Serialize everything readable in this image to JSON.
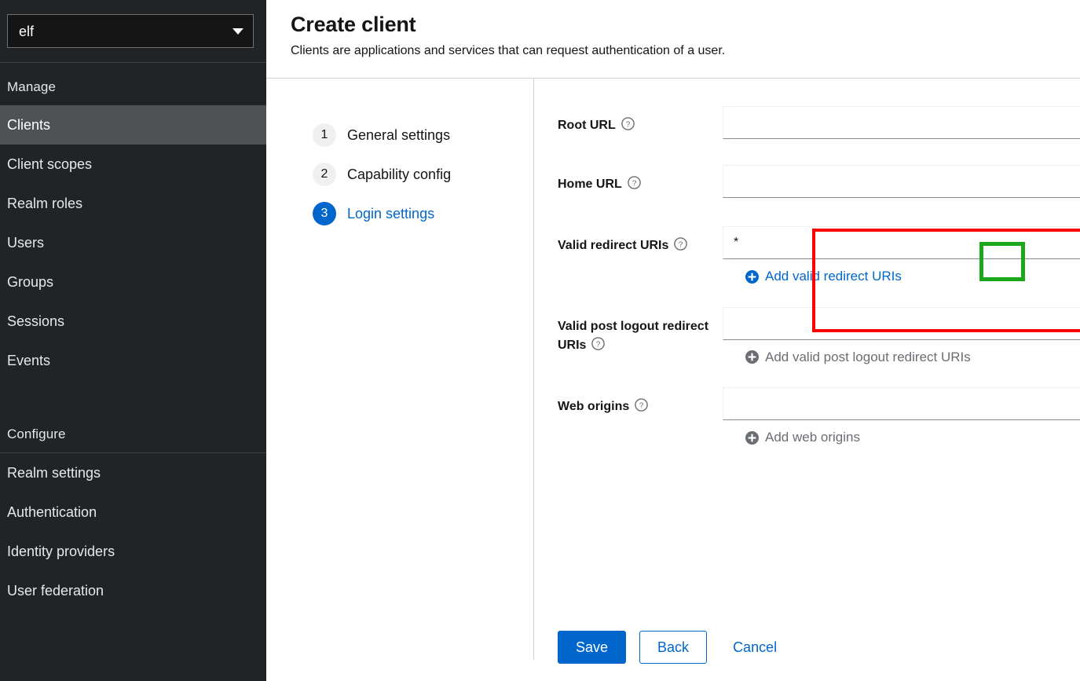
{
  "sidebar": {
    "realm_selector": {
      "value": "elf",
      "icon": "chevron-down-icon"
    },
    "groups": [
      {
        "title": "Manage",
        "items": [
          {
            "label": "Clients",
            "active": true
          },
          {
            "label": "Client scopes",
            "active": false
          },
          {
            "label": "Realm roles",
            "active": false
          },
          {
            "label": "Users",
            "active": false
          },
          {
            "label": "Groups",
            "active": false
          },
          {
            "label": "Sessions",
            "active": false
          },
          {
            "label": "Events",
            "active": false
          }
        ]
      },
      {
        "title": "Configure",
        "items": [
          {
            "label": "Realm settings",
            "active": false
          },
          {
            "label": "Authentication",
            "active": false
          },
          {
            "label": "Identity providers",
            "active": false
          },
          {
            "label": "User federation",
            "active": false
          }
        ]
      }
    ]
  },
  "header": {
    "title": "Create client",
    "subtitle": "Clients are applications and services that can request authentication of a user."
  },
  "wizard": {
    "steps": [
      {
        "num": "1",
        "label": "General settings",
        "current": false
      },
      {
        "num": "2",
        "label": "Capability config",
        "current": false
      },
      {
        "num": "3",
        "label": "Login settings",
        "current": true
      }
    ]
  },
  "form": {
    "root_url": {
      "label": "Root URL",
      "help_icon": "help-circle-icon",
      "value": "",
      "placeholder": ""
    },
    "home_url": {
      "label": "Home URL",
      "help_icon": "help-circle-icon",
      "value": "",
      "placeholder": ""
    },
    "valid_redirect_uris": {
      "label": "Valid redirect URIs",
      "help_icon": "help-circle-icon",
      "value": "*",
      "placeholder": "",
      "add_label": "Add valid redirect URIs",
      "add_icon": "plus-circle-icon",
      "add_enabled": true
    },
    "valid_post_logout_redirect_uris": {
      "label": "Valid post logout redirect URIs",
      "help_icon": "help-circle-icon",
      "value": "",
      "placeholder": "",
      "add_label": "Add valid post logout redirect URIs",
      "add_icon": "plus-circle-icon",
      "add_enabled": false
    },
    "web_origins": {
      "label": "Web origins",
      "help_icon": "help-circle-icon",
      "value": "",
      "placeholder": "",
      "add_label": "Add web origins",
      "add_icon": "plus-circle-icon",
      "add_enabled": false
    }
  },
  "actions": {
    "save": "Save",
    "back": "Back",
    "cancel": "Cancel"
  },
  "annotations": {
    "highlight_box_color": "#ff0000",
    "target_box_color": "#1aa81a"
  },
  "colors": {
    "sidebar_bg": "#212427",
    "sidebar_active": "#4f5255",
    "accent_blue": "#0066cc",
    "page_bg": "#ffffff",
    "muted_text": "#6a6e73"
  }
}
